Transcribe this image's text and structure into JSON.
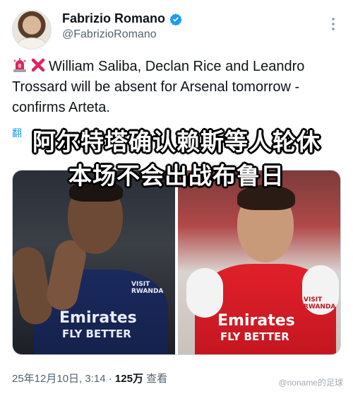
{
  "author": {
    "display_name": "Fabrizio Romano",
    "handle": "@FabrizioRomano",
    "verified_color": "#1d9bf0"
  },
  "tweet": {
    "text": "William Saliba, Declan Rice and Leandro Trossard will be absent for Arsenal tomorrow - confirms Arteta.",
    "emojis": [
      "siren-icon",
      "cross-icon"
    ]
  },
  "translate_hint": "翻",
  "overlay": {
    "line1": "阿尔特塔确认赖斯等人轮休",
    "line2": "本场不会出战布鲁日"
  },
  "media": {
    "left_sponsor": "Emirates",
    "left_sponsor2": "FLY BETTER",
    "left_sleeve": "VISIT RWANDA",
    "right_sponsor": "Emirates",
    "right_sponsor2": "FLY BETTER",
    "right_sleeve": "VISIT RWANDA"
  },
  "meta": {
    "date": "25年12月10日, 3:14 ·",
    "views": "125万",
    "views_label": "查看"
  },
  "watermark": "@noname的足球"
}
